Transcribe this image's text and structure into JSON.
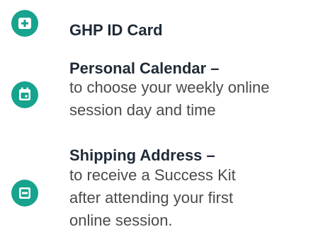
{
  "items": [
    {
      "icon": "plus-card-icon",
      "title": "GHP ID Card",
      "description_lines": []
    },
    {
      "icon": "calendar-icon",
      "title": "Personal Calendar –",
      "description_lines": [
        "to choose your weekly online",
        "session day and time"
      ]
    },
    {
      "icon": "address-card-icon",
      "title": "Shipping Address –",
      "description_lines": [
        "to receive a Success Kit",
        "after attending your first",
        "online session."
      ]
    }
  ],
  "colors": {
    "accent": "#17a38d",
    "title": "#1f2a36",
    "body": "#4a4a4a"
  }
}
